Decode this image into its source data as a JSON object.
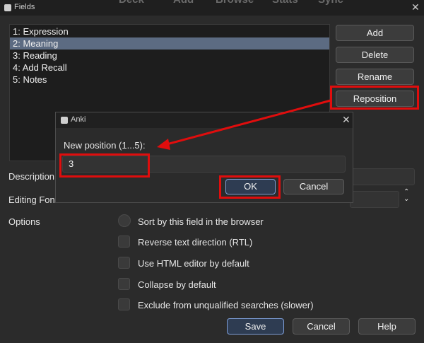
{
  "background_menu": [
    "Deck",
    "Add",
    "Browse",
    "Stats",
    "Sync"
  ],
  "window": {
    "title": "Fields"
  },
  "fields": [
    {
      "label": "1: Expression",
      "selected": false
    },
    {
      "label": "2: Meaning",
      "selected": true
    },
    {
      "label": "3: Reading",
      "selected": false
    },
    {
      "label": "4: Add Recall",
      "selected": false
    },
    {
      "label": "5: Notes",
      "selected": false
    }
  ],
  "side_buttons": {
    "add": "Add",
    "delete": "Delete",
    "rename": "Rename",
    "reposition": "Reposition"
  },
  "labels": {
    "description": "Description",
    "editing_font": "Editing Font",
    "options": "Options"
  },
  "options": [
    "Sort by this field in the browser",
    "Reverse text direction (RTL)",
    "Use HTML editor by default",
    "Collapse by default",
    "Exclude from unqualified searches (slower)"
  ],
  "bottom_buttons": {
    "save": "Save",
    "cancel": "Cancel",
    "help": "Help"
  },
  "dialog": {
    "title": "Anki",
    "prompt": "New position (1...5):",
    "value": "3",
    "ok": "OK",
    "cancel": "Cancel"
  },
  "colors": {
    "highlight": "#e00d0d",
    "selection": "#5c6b82",
    "primary_border": "#7d9dd6"
  },
  "icons": {
    "close": "close-icon",
    "app": "anki-app-icon",
    "spinner": "spinner-arrows-icon"
  }
}
